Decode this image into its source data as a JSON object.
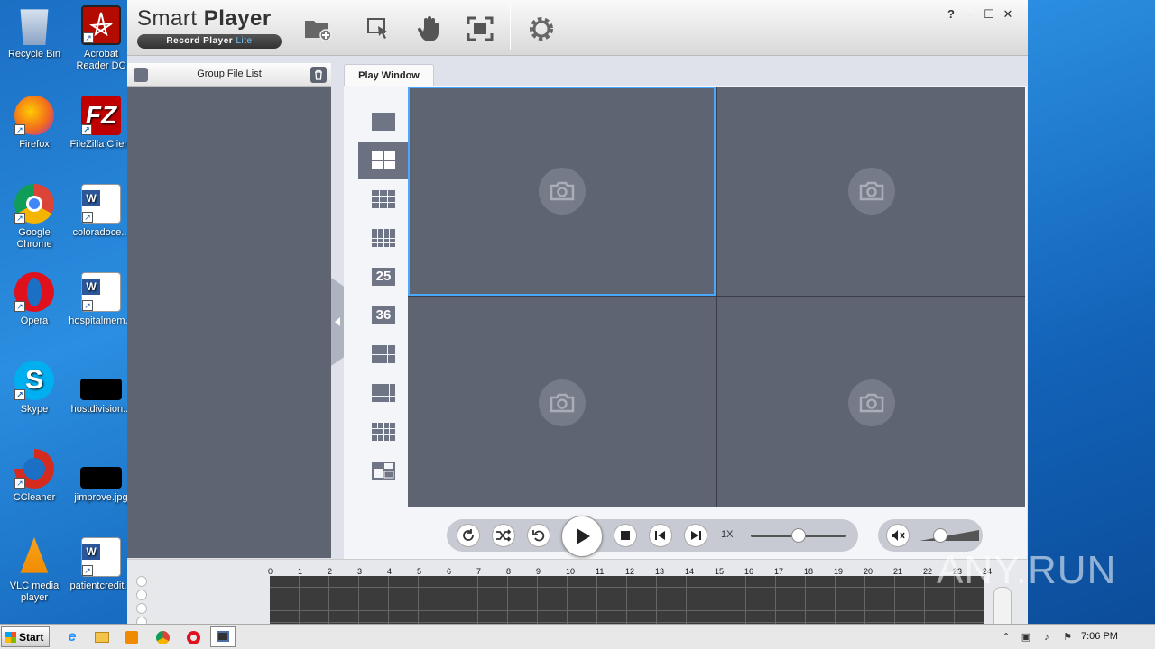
{
  "desktop": {
    "icons": [
      {
        "label": "Recycle Bin",
        "color": "#9fb8d8"
      },
      {
        "label": "Acrobat Reader DC",
        "color": "#b30b00"
      },
      {
        "label": "Firefox",
        "color": "#f26b1d"
      },
      {
        "label": "FileZilla Client",
        "color": "#c00000"
      },
      {
        "label": "Google Chrome",
        "color": "#4285f4"
      },
      {
        "label": "coloradoce...",
        "color": "#2b579a"
      },
      {
        "label": "Opera",
        "color": "#e0101d"
      },
      {
        "label": "hospitalmem...",
        "color": "#2b579a"
      },
      {
        "label": "Skype",
        "color": "#00aff0"
      },
      {
        "label": "hostdivision...",
        "color": "#000000"
      },
      {
        "label": "CCleaner",
        "color": "#d52b1e"
      },
      {
        "label": "jimprove.jpg",
        "color": "#000000"
      },
      {
        "label": "VLC media player",
        "color": "#f08a00"
      },
      {
        "label": "patientcredit..."
      }
    ]
  },
  "app": {
    "title_light": "Smart ",
    "title_bold": "Player",
    "subtitle": "Record Player ",
    "subtitle_lite": "Lite",
    "window_controls": {
      "help": "?",
      "minimize": "−",
      "maximize": "☐",
      "close": "✕"
    },
    "left_panel": {
      "title": "Group File List"
    },
    "play_tab": "Play Window",
    "layouts": [
      {
        "name": "1"
      },
      {
        "name": "4",
        "active": true
      },
      {
        "name": "9"
      },
      {
        "name": "16"
      },
      {
        "name": "25",
        "label": "25"
      },
      {
        "name": "36",
        "label": "36"
      },
      {
        "name": "6"
      },
      {
        "name": "8"
      },
      {
        "name": "13"
      },
      {
        "name": "custom"
      }
    ],
    "controls": {
      "speed": "1X",
      "progress": 0.5,
      "volume": 0.35
    },
    "timeline": {
      "hours": [
        "0",
        "1",
        "2",
        "3",
        "4",
        "5",
        "6",
        "7",
        "8",
        "9",
        "10",
        "11",
        "12",
        "13",
        "14",
        "15",
        "16",
        "17",
        "18",
        "19",
        "20",
        "21",
        "22",
        "23",
        "24"
      ]
    }
  },
  "taskbar": {
    "start_label": "Start",
    "clock": "7:06 PM"
  },
  "watermark": "ANY.RUN",
  "colors": {
    "accent": "#4aa8ff",
    "panel": "#5f6472"
  }
}
